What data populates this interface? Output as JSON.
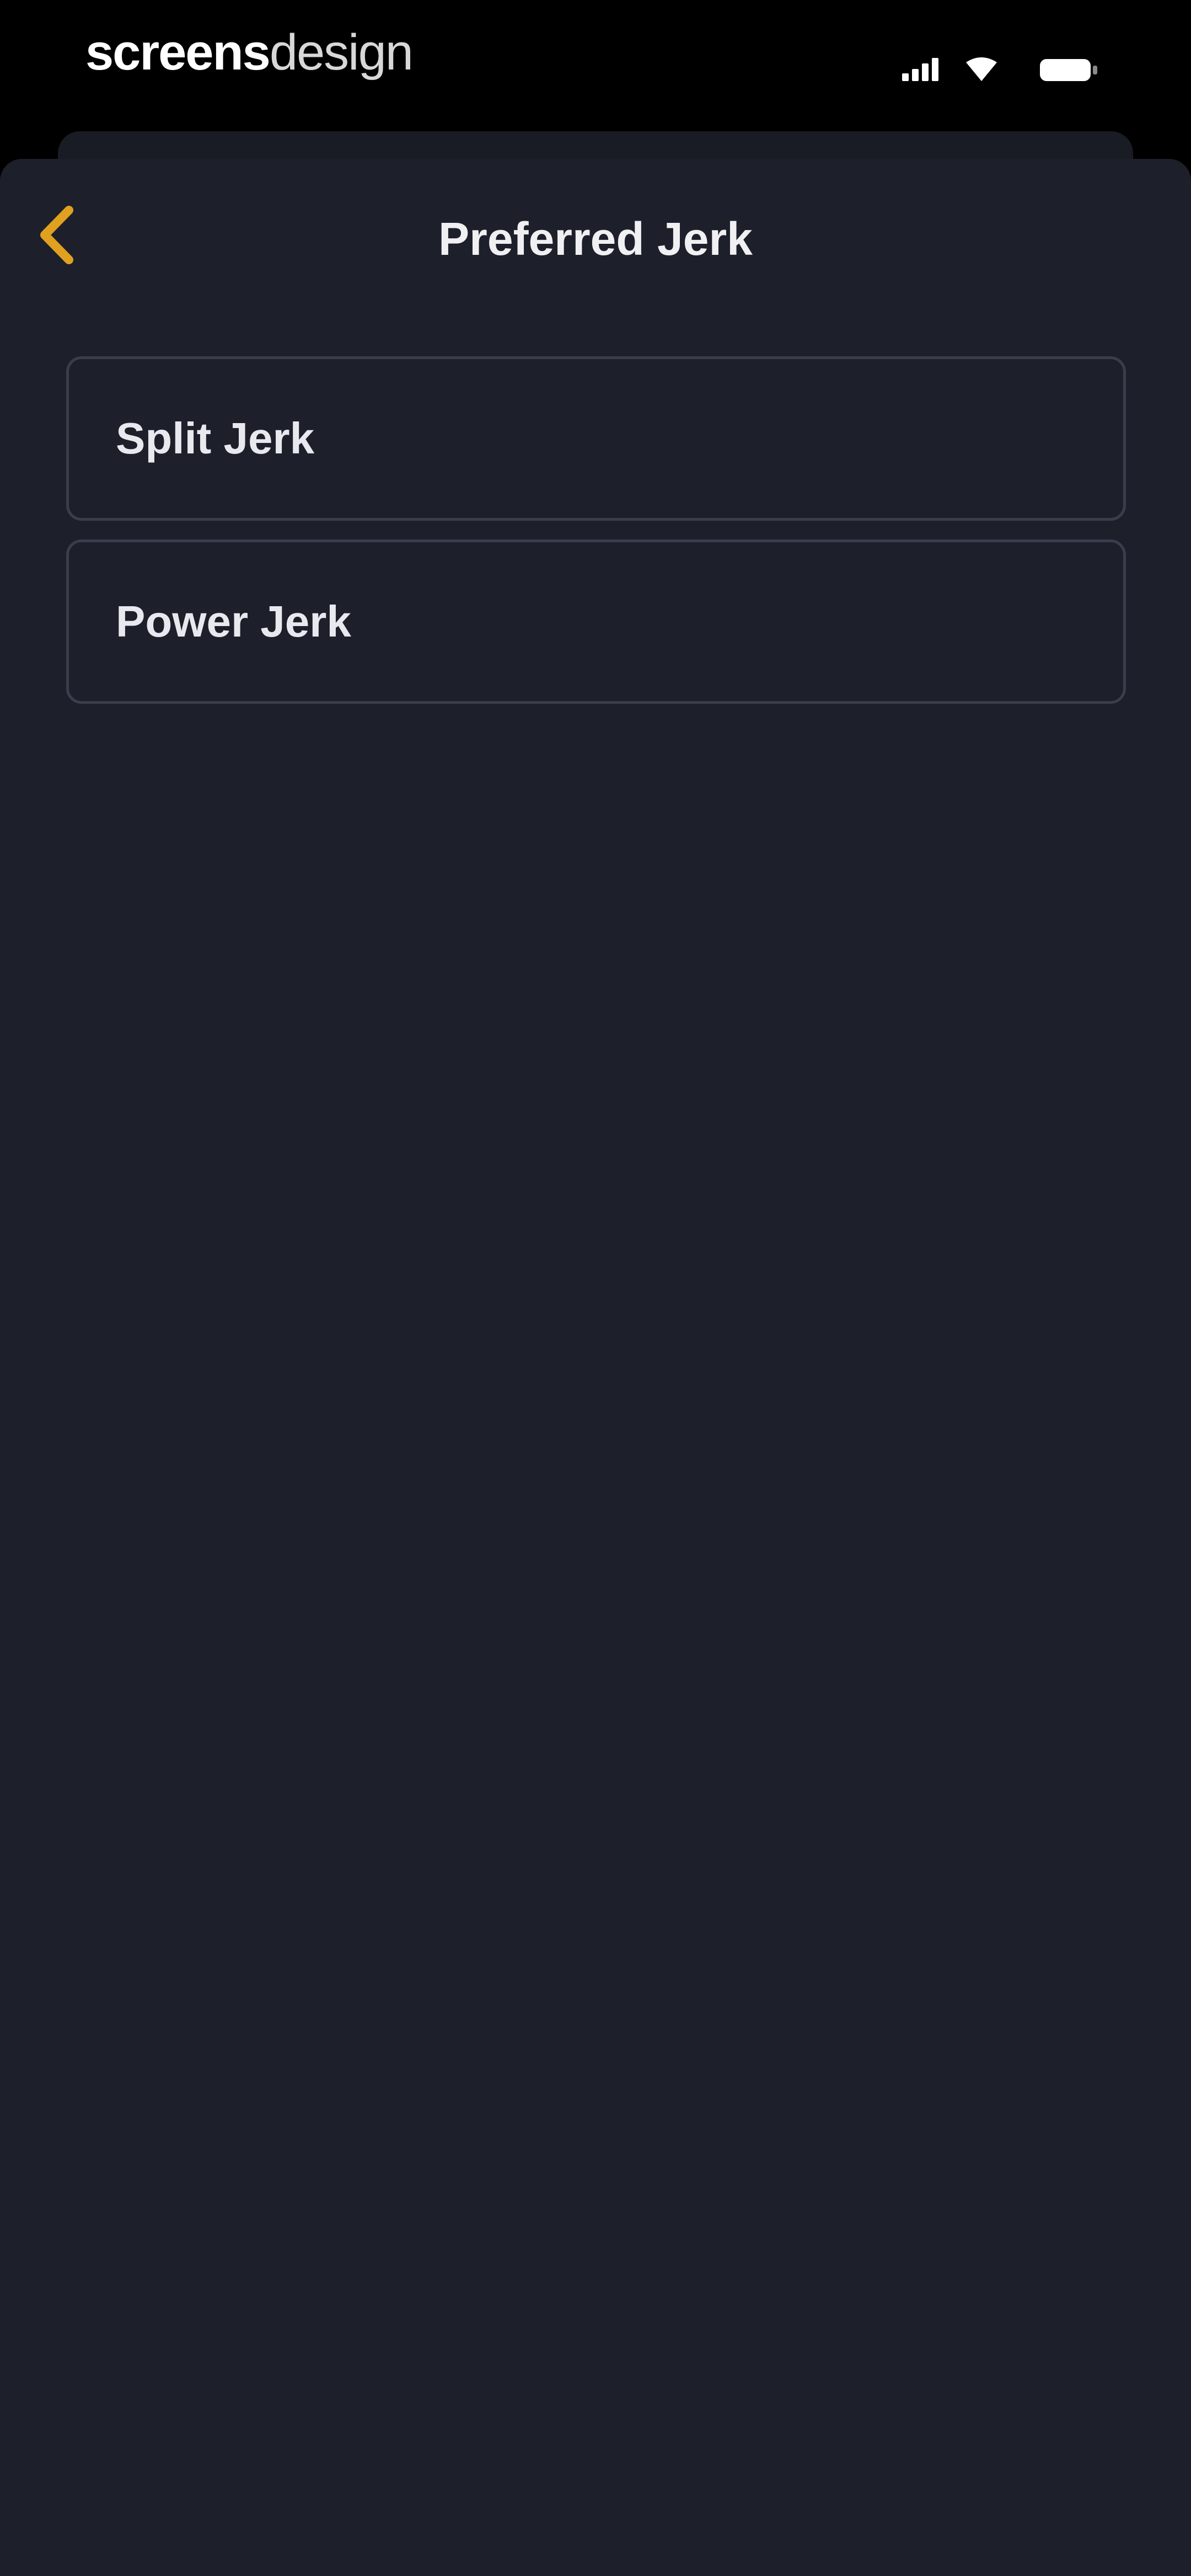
{
  "status_bar": {
    "brand_left": "screens",
    "brand_right": "design",
    "icons": [
      "cellular-signal-icon",
      "wifi-icon",
      "battery-icon"
    ]
  },
  "nav": {
    "back_icon": "chevron-left-icon",
    "title": "Preferred Jerk"
  },
  "options": [
    {
      "label": "Split Jerk"
    },
    {
      "label": "Power Jerk"
    }
  ],
  "colors": {
    "accent": "#e0a020",
    "background": "#1d202b",
    "card_border": "#3a3e4c",
    "text": "#f0f0f3"
  }
}
